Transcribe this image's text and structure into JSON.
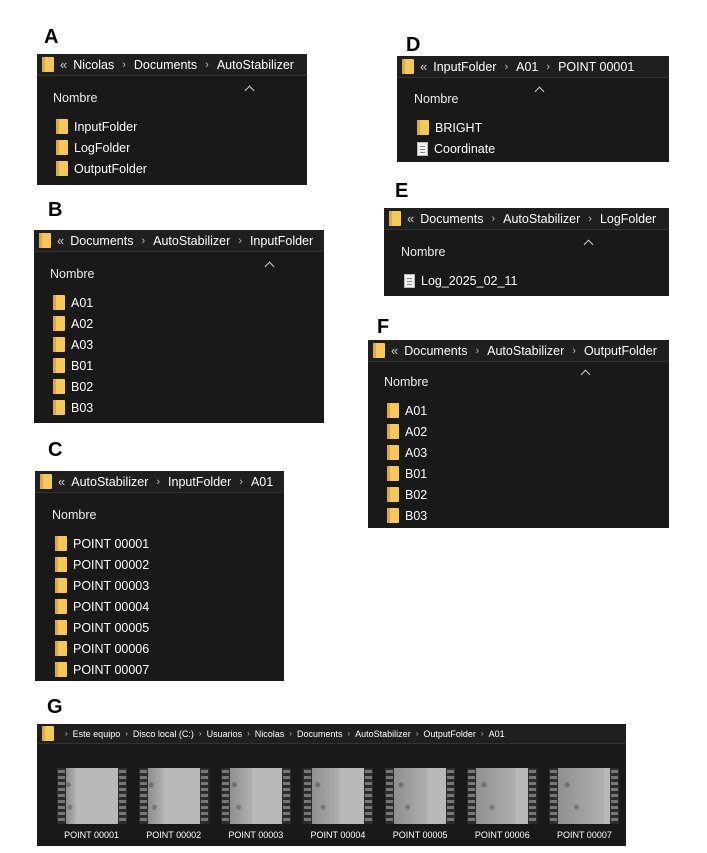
{
  "panels": {
    "A": {
      "letter": "A",
      "path": [
        "Nicolas",
        "Documents",
        "AutoStabilizer"
      ],
      "column": "Nombre",
      "items": [
        {
          "label": "InputFolder",
          "icon": "folder-icon"
        },
        {
          "label": "LogFolder",
          "icon": "folder-icon"
        },
        {
          "label": "OutputFolder",
          "icon": "folder-icon"
        }
      ]
    },
    "B": {
      "letter": "B",
      "path": [
        "Documents",
        "AutoStabilizer",
        "InputFolder"
      ],
      "column": "Nombre",
      "items": [
        {
          "label": "A01",
          "icon": "folder-icon"
        },
        {
          "label": "A02",
          "icon": "folder-icon"
        },
        {
          "label": "A03",
          "icon": "folder-icon"
        },
        {
          "label": "B01",
          "icon": "folder-icon"
        },
        {
          "label": "B02",
          "icon": "folder-icon"
        },
        {
          "label": "B03",
          "icon": "folder-icon"
        }
      ]
    },
    "C": {
      "letter": "C",
      "path": [
        "AutoStabilizer",
        "InputFolder",
        "A01"
      ],
      "column": "Nombre",
      "items": [
        {
          "label": "POINT 00001",
          "icon": "folder-icon"
        },
        {
          "label": "POINT 00002",
          "icon": "folder-icon"
        },
        {
          "label": "POINT 00003",
          "icon": "folder-icon"
        },
        {
          "label": "POINT 00004",
          "icon": "folder-icon"
        },
        {
          "label": "POINT 00005",
          "icon": "folder-icon"
        },
        {
          "label": "POINT 00006",
          "icon": "folder-icon"
        },
        {
          "label": "POINT 00007",
          "icon": "folder-icon"
        }
      ]
    },
    "D": {
      "letter": "D",
      "path": [
        "InputFolder",
        "A01",
        "POINT 00001"
      ],
      "column": "Nombre",
      "items": [
        {
          "label": "BRIGHT",
          "icon": "folder-icon"
        },
        {
          "label": "Coordinate",
          "icon": "document-icon"
        }
      ]
    },
    "E": {
      "letter": "E",
      "path": [
        "Documents",
        "AutoStabilizer",
        "LogFolder"
      ],
      "column": "Nombre",
      "items": [
        {
          "label": "Log_2025_02_11",
          "icon": "document-icon"
        }
      ]
    },
    "F": {
      "letter": "F",
      "path": [
        "Documents",
        "AutoStabilizer",
        "OutputFolder"
      ],
      "column": "Nombre",
      "items": [
        {
          "label": "A01",
          "icon": "folder-icon"
        },
        {
          "label": "A02",
          "icon": "folder-icon"
        },
        {
          "label": "A03",
          "icon": "folder-icon"
        },
        {
          "label": "B01",
          "icon": "folder-icon"
        },
        {
          "label": "B02",
          "icon": "folder-icon"
        },
        {
          "label": "B03",
          "icon": "folder-icon"
        }
      ]
    },
    "G": {
      "letter": "G",
      "path": [
        "Este equipo",
        "Disco local (C:)",
        "Usuarios",
        "Nicolas",
        "Documents",
        "AutoStabilizer",
        "OutputFolder",
        "A01"
      ],
      "videos": [
        {
          "label": "POINT 00001"
        },
        {
          "label": "POINT 00002"
        },
        {
          "label": "POINT 00003"
        },
        {
          "label": "POINT 00004"
        },
        {
          "label": "POINT 00005"
        },
        {
          "label": "POINT 00006"
        },
        {
          "label": "POINT 00007"
        }
      ]
    }
  },
  "ui": {
    "address_overflow": "«",
    "breadcrumb_separator": "›",
    "sort_indicator": "^"
  },
  "colors": {
    "window_bg": "#191919",
    "folder": "#f5c85a"
  }
}
